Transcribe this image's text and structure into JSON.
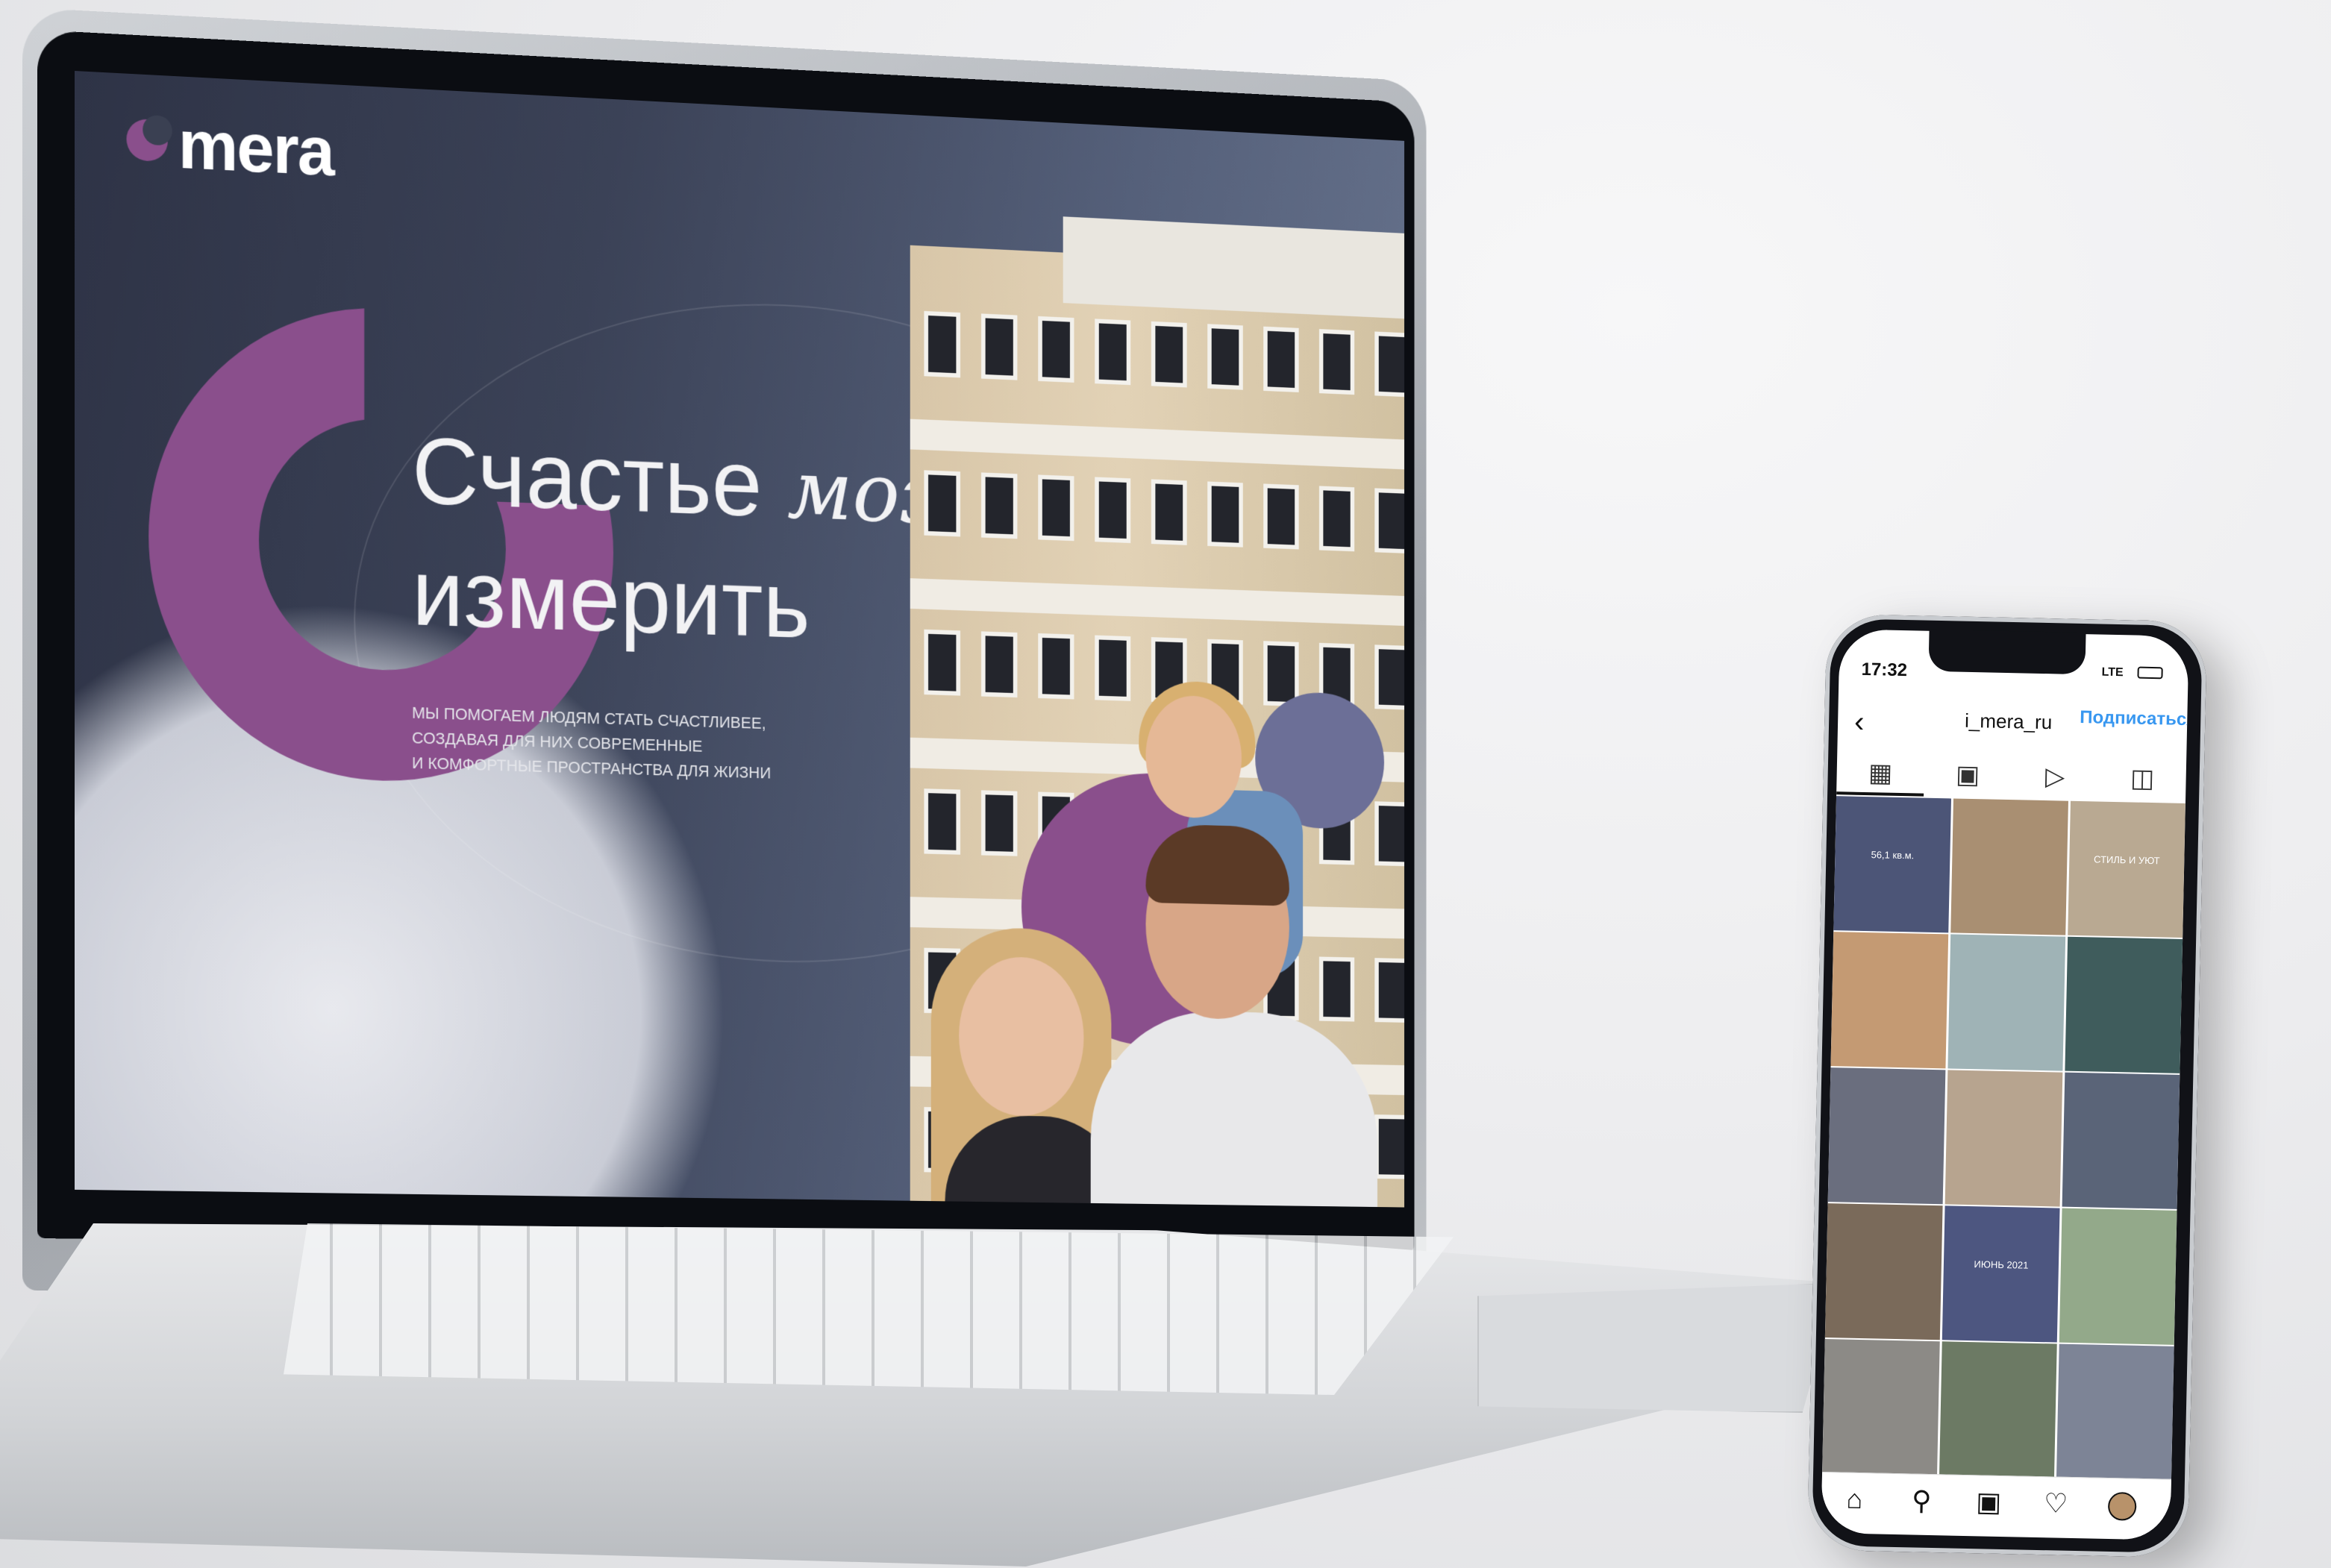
{
  "laptop": {
    "logo_text": "mera",
    "headline_line1_normal": "Счастье ",
    "headline_line1_italic": "можно",
    "headline_line2": "измерить",
    "subtitle_lines": [
      "МЫ ПОМОГАЕМ ЛЮДЯМ СТАТЬ СЧАСТЛИВЕЕ,",
      "СОЗДАВАЯ ДЛЯ НИХ СОВРЕМЕННЫЕ",
      "И КОМФОРТНЫЕ ПРОСТРАНСТВА ДЛЯ ЖИЗНИ"
    ],
    "colors": {
      "accent": "#8a4f8c",
      "background": "#3b4257",
      "text": "#f2f2f4"
    }
  },
  "phone": {
    "status_time": "17:32",
    "status_network": "LTE",
    "username": "i_mera_ru",
    "follow_button": "Подписаться",
    "tabs": [
      "grid-icon",
      "reels-icon",
      "play-icon",
      "tagged-icon"
    ],
    "tiles": [
      {
        "caption": "56,1 кв.м.",
        "color": "#4c5577"
      },
      {
        "caption": "",
        "color": "#a98f72"
      },
      {
        "caption": "СТИЛЬ И УЮТ",
        "color": "#b9a992"
      },
      {
        "caption": "",
        "color": "#c49a73"
      },
      {
        "caption": "",
        "color": "#9fb3b6"
      },
      {
        "caption": "",
        "color": "#3f5c5c"
      },
      {
        "caption": "",
        "color": "#6a6e7e"
      },
      {
        "caption": "",
        "color": "#b7a48f"
      },
      {
        "caption": "",
        "color": "#5a6478"
      },
      {
        "caption": "",
        "color": "#7a6a5a"
      },
      {
        "caption": "ИЮНЬ 2021",
        "color": "#4d5680"
      },
      {
        "caption": "",
        "color": "#93a98a"
      },
      {
        "caption": "",
        "color": "#8c8a86"
      },
      {
        "caption": "",
        "color": "#6c7a64"
      },
      {
        "caption": "",
        "color": "#7d8496"
      }
    ],
    "nav": [
      "home-icon",
      "search-icon",
      "reels-icon",
      "heart-icon",
      "profile-avatar"
    ],
    "colors": {
      "follow": "#3897f0"
    }
  }
}
